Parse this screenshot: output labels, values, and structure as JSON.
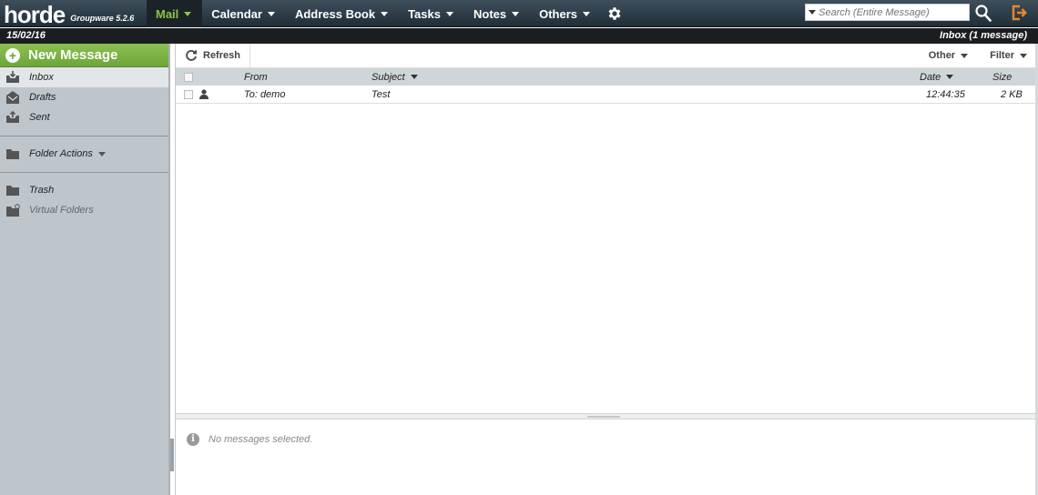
{
  "app": {
    "logo": "horde",
    "version": "Groupware 5.2.6"
  },
  "menu": [
    {
      "label": "Mail"
    },
    {
      "label": "Calendar"
    },
    {
      "label": "Address Book"
    },
    {
      "label": "Tasks"
    },
    {
      "label": "Notes"
    },
    {
      "label": "Others"
    }
  ],
  "search": {
    "placeholder": "Search (Entire Message)"
  },
  "status": {
    "date": "15/02/16",
    "mailbox": "Inbox (1 message)"
  },
  "sidebar": {
    "new_message": "New Message",
    "folders": [
      {
        "label": "Inbox"
      },
      {
        "label": "Drafts"
      },
      {
        "label": "Sent"
      }
    ],
    "folder_actions": "Folder Actions",
    "extra": [
      {
        "label": "Trash"
      },
      {
        "label": "Virtual Folders"
      }
    ]
  },
  "toolbar": {
    "refresh": "Refresh",
    "other": "Other",
    "filter": "Filter"
  },
  "columns": {
    "from": "From",
    "subject": "Subject",
    "date": "Date",
    "size": "Size"
  },
  "messages": [
    {
      "from": "To: demo",
      "subject": "Test",
      "date": "12:44:35",
      "size": "2 KB"
    }
  ],
  "preview": {
    "empty": "No messages selected."
  },
  "colors": {
    "accent": "#8bc34a",
    "topbar": "#2b3a45",
    "sidebar": "#bec6cc"
  }
}
